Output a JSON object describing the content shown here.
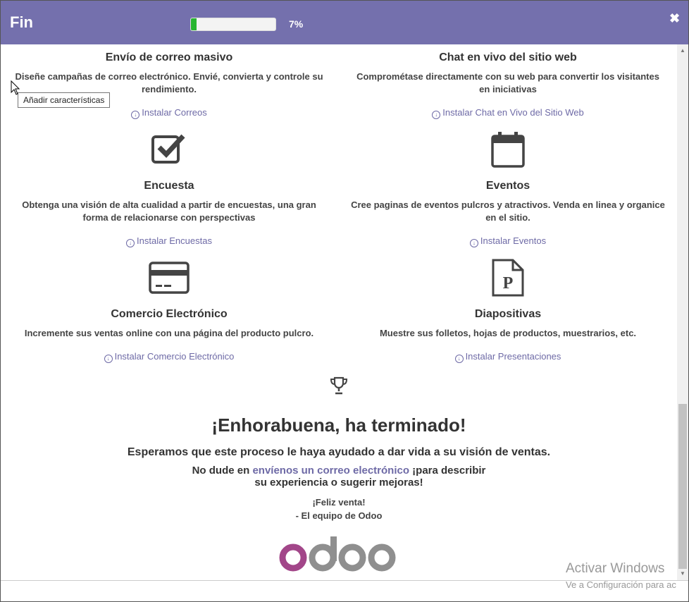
{
  "header": {
    "title": "Fin",
    "progress_label": "7%",
    "progress_fraction": 0.07,
    "close_glyph": "✖"
  },
  "colors": {
    "header_bg": "#7470ad",
    "accent": "#6e6aa6",
    "progress": "#28b531"
  },
  "tooltip": "Añadir características",
  "features": [
    {
      "title": "Envío de correo masivo",
      "desc": "Diseñe campañas de correo electrónico. Envié, convierta y controle su rendimiento.",
      "link": "Instalar Correos",
      "icon": ""
    },
    {
      "title": "Chat en vivo del sitio web",
      "desc": "Comprométase directamente con su web para convertir los visitantes en iniciativas",
      "link": "Instalar Chat en Vivo del Sitio Web",
      "icon": ""
    },
    {
      "title": "Encuesta",
      "desc": "Obtenga una visión de alta cualidad a partir de encuestas, una gran forma de relacionarse con perspectivas",
      "link": "Instalar Encuestas",
      "icon": "checkbox-icon"
    },
    {
      "title": "Eventos",
      "desc": "Cree paginas de eventos pulcros y atractivos. Venda en linea y organice en el sitio.",
      "link": "Instalar Eventos",
      "icon": "calendar-icon"
    },
    {
      "title": "Comercio Electrónico",
      "desc": "Incremente sus ventas online con una página del producto pulcro.",
      "link": "Instalar Comercio Electrónico",
      "icon": "credit-card-icon"
    },
    {
      "title": "Diapositivas",
      "desc": "Muestre sus folletos, hojas de productos, muestrarios, etc.",
      "link": "Instalar Presentaciones",
      "icon": "presentation-file-icon"
    }
  ],
  "final": {
    "heading": "¡Enhorabuena, ha terminado!",
    "line1": "Esperamos que este proceso le haya ayudado a dar vida a su visión de ventas.",
    "line2_pre": "No dude en ",
    "line2_link": "envíenos un correo electrónico",
    "line2_post": " ¡para describir",
    "line3": "su experiencia o sugerir mejoras!",
    "sign1": "¡Feliz venta!",
    "sign2": "- El equipo de Odoo",
    "logo": "odoo"
  },
  "watermark": {
    "line1": "Activar Windows",
    "line2": "Ve a Configuración para ac"
  }
}
